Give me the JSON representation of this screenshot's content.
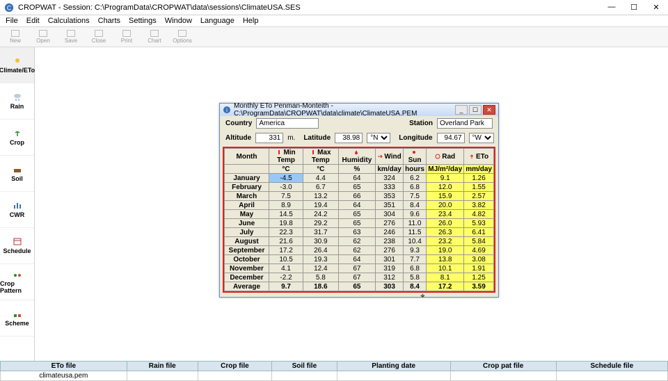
{
  "window": {
    "title": "CROPWAT - Session: C:\\ProgramData\\CROPWAT\\data\\sessions\\ClimateUSA.SES",
    "btn_min": "—",
    "btn_max": "☐",
    "btn_close": "✕"
  },
  "menu": [
    "File",
    "Edit",
    "Calculations",
    "Charts",
    "Settings",
    "Window",
    "Language",
    "Help"
  ],
  "toolbar": [
    "New",
    "Open",
    "Save",
    "Close",
    "Print",
    "Chart",
    "Options"
  ],
  "sidebar": [
    {
      "label": "Climate/ETo"
    },
    {
      "label": "Rain"
    },
    {
      "label": "Crop"
    },
    {
      "label": "Soil"
    },
    {
      "label": "CWR"
    },
    {
      "label": "Schedule"
    },
    {
      "label": "Crop Pattern"
    },
    {
      "label": "Scheme"
    }
  ],
  "sidebar_icons": [
    "sun-icon",
    "rain-icon",
    "plant-icon",
    "soil-icon",
    "cwr-icon",
    "schedule-icon",
    "crop-pattern-icon",
    "scheme-icon"
  ],
  "subwin": {
    "title": "Monthly ETo Penman-Monteith - C:\\ProgramData\\CROPWAT\\data\\climate\\ClimateUSA.PEM",
    "country_lbl": "Country",
    "country": "America",
    "station_lbl": "Station",
    "station": "Overland Park",
    "altitude_lbl": "Altitude",
    "altitude": "331",
    "altitude_unit": "m.",
    "latitude_lbl": "Latitude",
    "latitude": "38.98",
    "lat_dir": "°N",
    "longitude_lbl": "Longitude",
    "longitude": "94.67",
    "lon_dir": "°W"
  },
  "headers": [
    "Month",
    "Min Temp",
    "Max Temp",
    "Humidity",
    "Wind",
    "Sun",
    "Rad",
    "ETo"
  ],
  "units": [
    "",
    "°C",
    "°C",
    "%",
    "km/day",
    "hours",
    "MJ/m²/day",
    "mm/day"
  ],
  "chart_data": {
    "type": "table",
    "title": "Monthly ETo Penman-Monteith",
    "columns": [
      "Month",
      "Min Temp (°C)",
      "Max Temp (°C)",
      "Humidity (%)",
      "Wind (km/day)",
      "Sun (hours)",
      "Rad (MJ/m²/day)",
      "ETo (mm/day)"
    ],
    "rows": [
      [
        "January",
        "-4.5",
        "4.4",
        "64",
        "324",
        "6.2",
        "9.1",
        "1.26"
      ],
      [
        "February",
        "-3.0",
        "6.7",
        "65",
        "333",
        "6.8",
        "12.0",
        "1.55"
      ],
      [
        "March",
        "7.5",
        "13.2",
        "66",
        "353",
        "7.5",
        "15.9",
        "2.57"
      ],
      [
        "April",
        "8.9",
        "19.4",
        "64",
        "351",
        "8.4",
        "20.0",
        "3.82"
      ],
      [
        "May",
        "14.5",
        "24.2",
        "65",
        "304",
        "9.6",
        "23.4",
        "4.82"
      ],
      [
        "June",
        "19.8",
        "29.2",
        "65",
        "276",
        "11.0",
        "26.0",
        "5.93"
      ],
      [
        "July",
        "22.3",
        "31.7",
        "63",
        "246",
        "11.5",
        "26.3",
        "6.41"
      ],
      [
        "August",
        "21.6",
        "30.9",
        "62",
        "238",
        "10.4",
        "23.2",
        "5.84"
      ],
      [
        "September",
        "17.2",
        "26.4",
        "62",
        "276",
        "9.3",
        "19.0",
        "4.69"
      ],
      [
        "October",
        "10.5",
        "19.3",
        "64",
        "301",
        "7.7",
        "13.8",
        "3.08"
      ],
      [
        "November",
        "4.1",
        "12.4",
        "67",
        "319",
        "6.8",
        "10.1",
        "1.91"
      ],
      [
        "December",
        "-2.2",
        "5.8",
        "67",
        "312",
        "5.8",
        "8.1",
        "1.25"
      ]
    ],
    "average": [
      "Average",
      "9.7",
      "18.6",
      "65",
      "303",
      "8.4",
      "17.2",
      "3.59"
    ]
  },
  "status": {
    "headers": [
      "ETo file",
      "Rain file",
      "Crop file",
      "Soil file",
      "Planting date",
      "Crop pat file",
      "Schedule file"
    ],
    "values": [
      "climateusa.pem",
      "",
      "",
      "",
      "",
      "",
      ""
    ]
  }
}
